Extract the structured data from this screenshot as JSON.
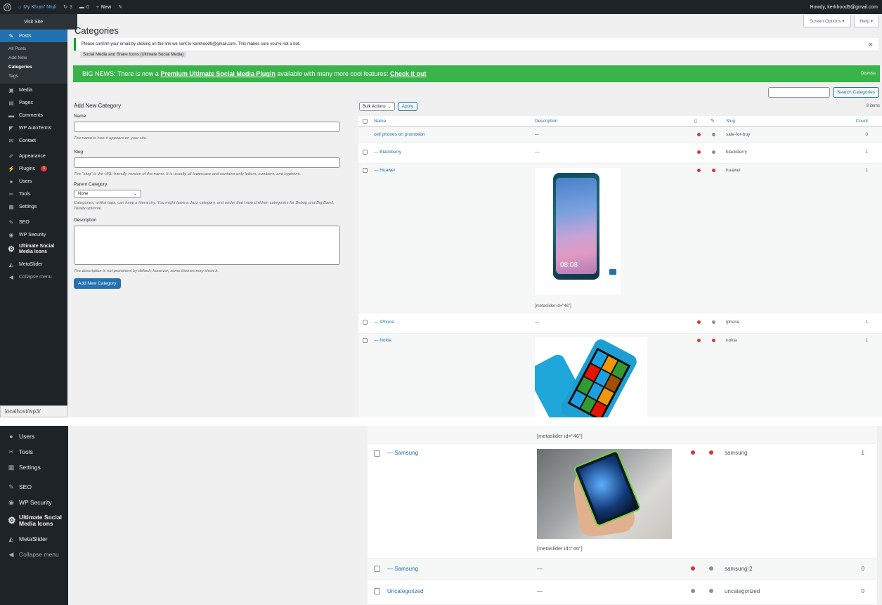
{
  "adminbar": {
    "site_name": "My Khum' Ntuli",
    "updates": "3",
    "comments": "0",
    "new_label": "New",
    "howdy": "Howdy, kerkhood9@gmail.com"
  },
  "visit_site": "Visit Site",
  "sidebar": {
    "items": [
      {
        "label": "Posts",
        "icon": "pin-icon"
      },
      {
        "label": "Media",
        "icon": "media-icon"
      },
      {
        "label": "Pages",
        "icon": "pages-icon"
      },
      {
        "label": "Comments",
        "icon": "comments-icon"
      },
      {
        "label": "WP AutoTerms",
        "icon": "autoterms-icon"
      },
      {
        "label": "Contact",
        "icon": "contact-icon"
      },
      {
        "label": "Appearance",
        "icon": "appearance-icon"
      },
      {
        "label": "Plugins",
        "icon": "plugins-icon",
        "badge": "3"
      },
      {
        "label": "Users",
        "icon": "users-icon"
      },
      {
        "label": "Tools",
        "icon": "tools-icon"
      },
      {
        "label": "Settings",
        "icon": "settings-icon"
      },
      {
        "label": "SEO",
        "icon": "seo-icon"
      },
      {
        "label": "WP Security",
        "icon": "shield-icon"
      },
      {
        "label": "Ultimate Social Media Icons",
        "icon": "social-icon"
      },
      {
        "label": "MetaSlider",
        "icon": "metaslider-icon"
      },
      {
        "label": "Collapse menu",
        "icon": "collapse-icon"
      }
    ],
    "submenu": [
      "All Posts",
      "Add New",
      "Categories",
      "Tags"
    ]
  },
  "status_url": "localhost/wp3/",
  "page_title": "Categories",
  "screen_options": "Screen Options ▾",
  "help": "Help ▾",
  "notice_text": "Please confirm your email by clicking on the link we sent to kerkhood9@gmail.com. This makes sure you're not a bot.",
  "plugin_tag": "Social Media and Share Icons (Ultimate Social Media)",
  "bignews": {
    "prefix": "BIG NEWS: There is now a ",
    "link": "Premium Ultimate Social Media Plugin",
    "middle": " available with many more cool features: ",
    "cta": "Check it out",
    "dismiss": "Dismiss"
  },
  "search_button": "Search Categories",
  "form": {
    "heading": "Add New Category",
    "name_label": "Name",
    "name_help": "The name is how it appears on your site.",
    "slug_label": "Slug",
    "slug_help": "The \"slug\" is the URL-friendly version of the name. It is usually all lowercase and contains only letters, numbers, and hyphens.",
    "parent_label": "Parent Category",
    "parent_value": "None",
    "parent_help": "Categories, unlike tags, can have a hierarchy. You might have a Jazz category, and under that have children categories for Bebop and Big Band. Totally optional.",
    "desc_label": "Description",
    "desc_help": "The description is not prominent by default; however, some themes may show it.",
    "submit": "Add New Category"
  },
  "table": {
    "bulk_actions": "Bulk Actions",
    "apply": "Apply",
    "items_count": "8 items",
    "headers": {
      "name": "Name",
      "description": "Description",
      "slug": "Slug",
      "count": "Count"
    },
    "metaslider_caption": "[metaslider id=\"46\"]",
    "rows": [
      {
        "name": "cell phones on promotion",
        "description": "—",
        "slug": "sale-for-buy",
        "count": "0",
        "dot1": "#d63638",
        "dot2": "#8c8f94"
      },
      {
        "name": "— Blackberry",
        "description": "—",
        "slug": "blackberry",
        "count": "1",
        "dot1": "#d63638",
        "dot2": "#8c8f94"
      },
      {
        "name": "— Huawei",
        "description": "",
        "slug": "huawei",
        "count": "1",
        "dot1": "#d63638",
        "dot2": "#d63638",
        "image_time": "08:08"
      },
      {
        "name": "— IPhone",
        "description": "—",
        "slug": "iphone",
        "count": "1",
        "dot1": "#d63638",
        "dot2": "#8c8f94"
      },
      {
        "name": "— Nokia",
        "description": "",
        "slug": "nokia",
        "count": "1",
        "dot1": "#d63638",
        "dot2": "#d63638"
      }
    ],
    "rows_bottom": [
      {
        "name": "— Samsung",
        "description": "",
        "slug": "samsung",
        "count": "1",
        "dot1": "#d63638",
        "dot2": "#d63638"
      },
      {
        "name": "— Samsung",
        "description": "—",
        "slug": "samsung-2",
        "count": "0",
        "dot1": "#d63638",
        "dot2": "#8c8f94"
      },
      {
        "name": "Uncategorized",
        "description": "—",
        "slug": "uncategorized",
        "count": "0",
        "dot1": "#8c8f94",
        "dot2": "#8c8f94"
      }
    ]
  },
  "bottom_sidebar": [
    {
      "label": "Users",
      "icon": "users-icon"
    },
    {
      "label": "Tools",
      "icon": "tools-icon"
    },
    {
      "label": "Settings",
      "icon": "settings-icon"
    },
    {
      "label": "SEO",
      "icon": "seo-icon"
    },
    {
      "label": "WP Security",
      "icon": "shield-icon"
    },
    {
      "label": "Ultimate Social Media Icons",
      "icon": "social-icon"
    },
    {
      "label": "MetaSlider",
      "icon": "metaslider-icon"
    },
    {
      "label": "Collapse menu",
      "icon": "collapse-icon"
    }
  ]
}
